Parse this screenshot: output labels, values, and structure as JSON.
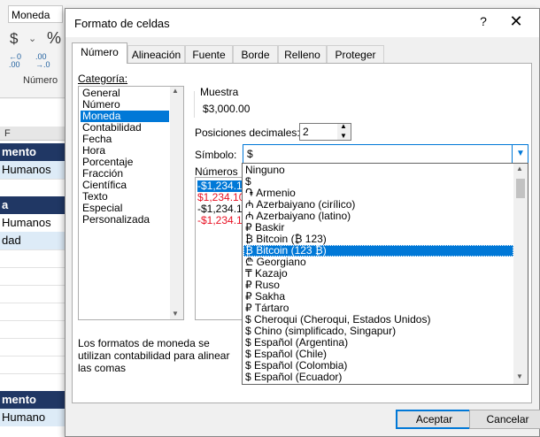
{
  "excel": {
    "number_format_value": "Moneda",
    "currency_symbol": "$",
    "currency_chevron": "⌄",
    "percent_symbol": "%",
    "increase_decimal": "←0\n.00",
    "decrease_decimal": ".00\n→.0",
    "group_label": "Número",
    "column_header": "F",
    "cells": [
      {
        "text": "mento",
        "style": "dark"
      },
      {
        "text": "Humanos",
        "style": "light"
      },
      {
        "text": "",
        "style": "plain"
      },
      {
        "text": "a",
        "style": "dark"
      },
      {
        "text": "Humanos",
        "style": "plain"
      },
      {
        "text": "dad",
        "style": "light"
      },
      {
        "text": "mento",
        "style": "dark"
      },
      {
        "text": "Humano",
        "style": "light"
      }
    ]
  },
  "dialog": {
    "title": "Formato de celdas",
    "help": "?",
    "close": "✕",
    "tabs": [
      "Número",
      "Alineación",
      "Fuente",
      "Borde",
      "Relleno",
      "Proteger"
    ],
    "active_tab": 0,
    "category_label": "Categoría:",
    "categories": [
      "General",
      "Número",
      "Moneda",
      "Contabilidad",
      "Fecha",
      "Hora",
      "Porcentaje",
      "Fracción",
      "Científica",
      "Texto",
      "Especial",
      "Personalizada"
    ],
    "selected_category": 2,
    "sample_label": "Muestra",
    "sample_value": "$3,000.00",
    "decimals_label": "Posiciones decimales:",
    "decimals_value": "2",
    "symbol_label": "Símbolo:",
    "symbol_value": "$",
    "negative_label": "Números n",
    "negative_items": [
      {
        "text": "-$1,234.1",
        "style": "sel"
      },
      {
        "text": "$1,234.10",
        "style": "red"
      },
      {
        "text": "-$1,234.10",
        "style": "plain"
      },
      {
        "text": "-$1,234.10",
        "style": "red"
      }
    ],
    "description": "Los formatos de moneda se utilizan contabilidad para alinear las comas",
    "symbol_options": [
      "Ninguno",
      "$",
      "֏ Armenio",
      "₼ Azerbaiyano (cirílico)",
      "₼ Azerbaiyano (latino)",
      "₽ Baskir",
      "₿ Bitcoin (₿ 123)",
      "₿ Bitcoin (123 ₿)",
      "₾ Georgiano",
      "₸ Kazajo",
      "₽ Ruso",
      "₽ Sakha",
      "₽ Tártaro",
      "$ Cheroqui (Cheroqui, Estados Unidos)",
      "$ Chino (simplificado, Singapur)",
      "$ Español (Argentina)",
      "$ Español (Chile)",
      "$ Español (Colombia)",
      "$ Español (Ecuador)"
    ],
    "selected_symbol_option": 7,
    "ok_label": "Aceptar",
    "cancel_label": "Cancelar"
  }
}
